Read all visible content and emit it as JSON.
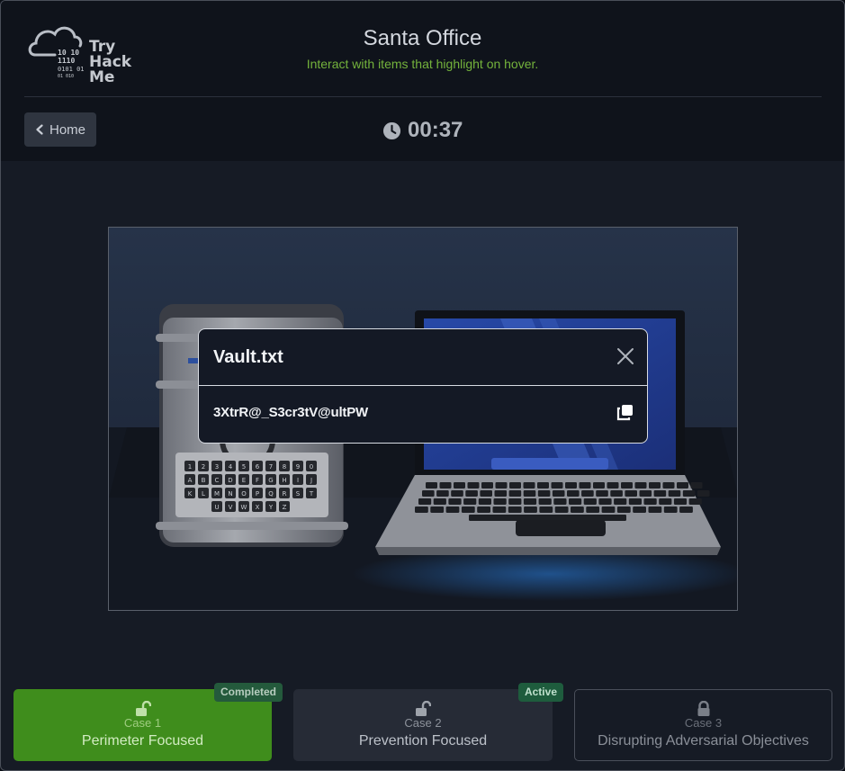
{
  "header": {
    "logo_text": [
      "Try",
      "Hack",
      "Me"
    ],
    "logo_binary": [
      "10  10",
      "1110",
      "0101  01",
      "01  010"
    ],
    "title": "Santa Office",
    "subtitle": "Interact with items that highlight on hover.",
    "home_label": "Home",
    "timer": "00:37"
  },
  "dialog": {
    "title": "Vault.txt",
    "content": "3XtrR@_S3cr3tV@ultPW"
  },
  "keypad": {
    "row1": [
      "1",
      "2",
      "3",
      "4",
      "5",
      "6",
      "7",
      "8",
      "9",
      "0"
    ],
    "row2": [
      "A",
      "B",
      "C",
      "D",
      "E",
      "F",
      "G",
      "H",
      "I",
      "J"
    ],
    "row3": [
      "K",
      "L",
      "M",
      "N",
      "O",
      "P",
      "Q",
      "R",
      "S",
      "T"
    ],
    "row4": [
      "U",
      "V",
      "W",
      "X",
      "Y",
      "Z"
    ]
  },
  "cases": [
    {
      "number": "Case 1",
      "name": "Perimeter Focused",
      "badge": "Completed",
      "state": "completed",
      "lock": "unlocked-icon"
    },
    {
      "number": "Case 2",
      "name": "Prevention Focused",
      "badge": "Active",
      "state": "active",
      "lock": "unlocked-icon"
    },
    {
      "number": "Case 3",
      "name": "Disrupting Adversarial Objectives",
      "badge": "",
      "state": "locked",
      "lock": "lock-icon"
    }
  ],
  "colors": {
    "accent_green": "#3f8d1c",
    "subtitle_green": "#74b33c",
    "badge_green": "#1e5c3d",
    "background": "#161b25"
  }
}
